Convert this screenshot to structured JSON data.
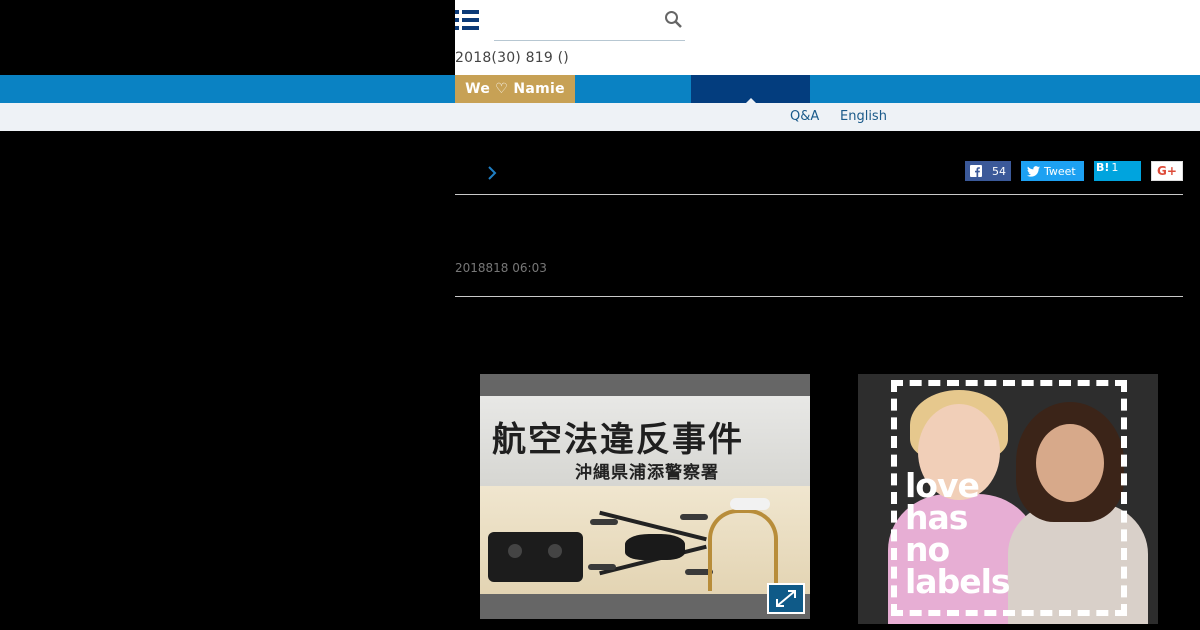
{
  "header": {
    "date_line": "2018(30) 819 ()",
    "search_placeholder": ""
  },
  "nav": {
    "namie_button": "We ♡ Namie"
  },
  "subnav": {
    "qa": "Q&A",
    "english": "English"
  },
  "share": {
    "facebook_count": "54",
    "tweet_label": "Tweet",
    "hatena_label": "B!",
    "hatena_count": "1",
    "gplus_label": "G+"
  },
  "article": {
    "timestamp": "2018818 06:03"
  },
  "photo1": {
    "banner_line1": "航空法違反事件",
    "banner_line2": "沖縄県浦添警察署"
  },
  "ad": {
    "text_lines": [
      "love",
      "has",
      "no",
      "labels"
    ]
  },
  "colors": {
    "nav_blue": "#0a82c3",
    "nav_active": "#033d7e",
    "namie_gold": "#c7a155",
    "subnav_bg": "#eef2f6"
  }
}
